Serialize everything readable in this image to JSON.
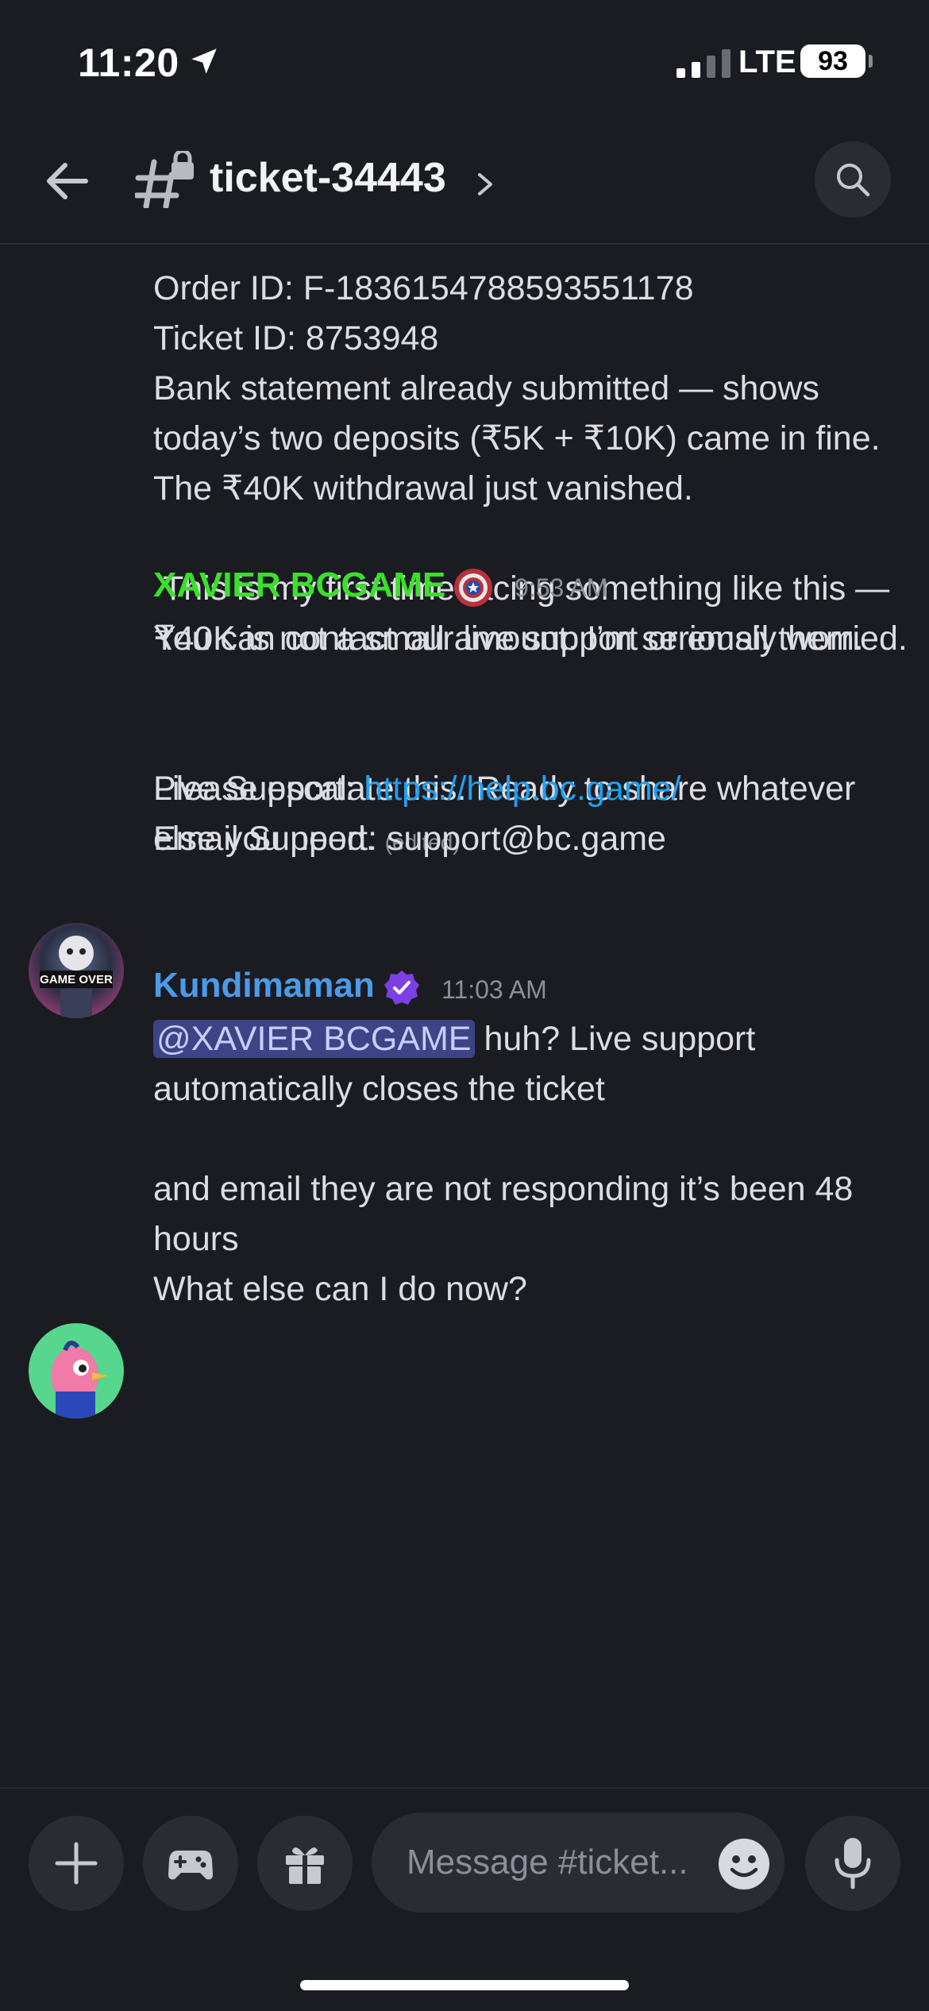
{
  "status_bar": {
    "time": "11:20",
    "carrier": "LTE",
    "battery": "93"
  },
  "header": {
    "channel_name": "ticket-34443"
  },
  "messages": {
    "continued": {
      "order_line": "Order ID: F-1836154788593551178",
      "ticket_line": "Ticket ID: 8753948",
      "paragraph1": "Bank statement already submitted — shows today’s two deposits (₹5K + ₹10K) came in fine. The ₹40K withdrawal just vanished.",
      "paragraph2": " This is my first time facing something like this — ₹40K is not a small amount. I’m seriously worried.",
      "paragraph3": "Please escalate this. Ready to share whatever else you need.",
      "edited_label": "(edited)"
    },
    "xavier": {
      "author": "XAVIER BCGAME",
      "author_color": "#3be02b",
      "time": "9:53 AM",
      "avatar_text": "GAME OVER",
      "line1": "You can contact our live support or email them.",
      "live_label": "Live Support: ",
      "live_link": "https://help.bc.game/",
      "email_line": "Email Support: support@bc.game"
    },
    "kundimaman": {
      "author": "Kundimaman",
      "author_color": "#4a9be8",
      "time": "11:03 AM",
      "mention": "@XAVIER BCGAME",
      "line1_rest": " huh? Live support automatically closes the ticket",
      "paragraph2": "and email they are not responding it’s been 48 hours",
      "paragraph3": "What else can I do now?"
    }
  },
  "composer": {
    "placeholder": "Message #ticket..."
  },
  "colors": {
    "background": "#1b1c22",
    "link": "#1ea0f2",
    "mention_bg": "#3c4486"
  }
}
